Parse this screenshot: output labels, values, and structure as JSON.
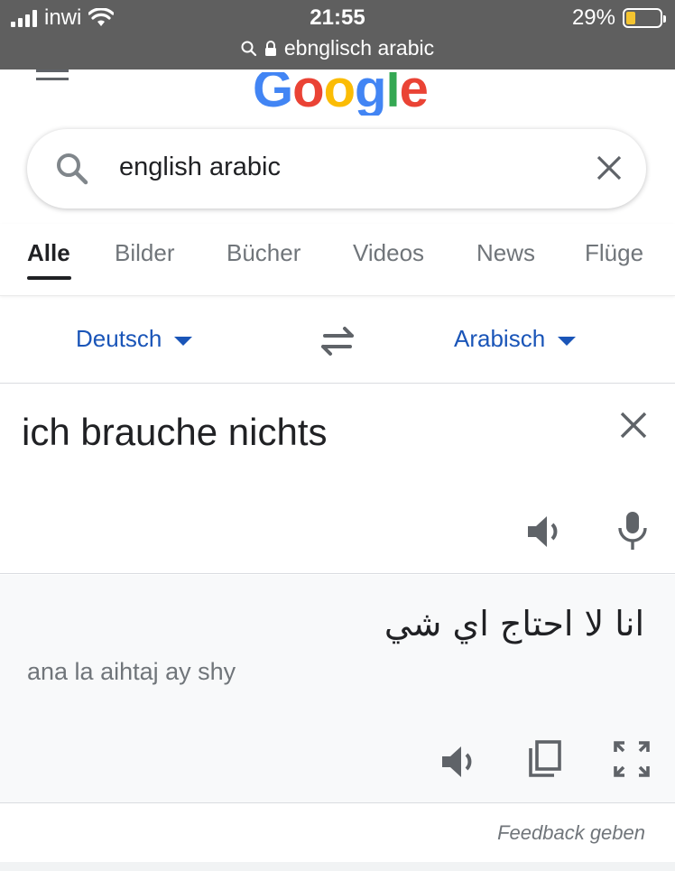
{
  "status_bar": {
    "carrier": "inwi",
    "time": "21:55",
    "battery_percent": "29%",
    "battery_level": 0.29,
    "url": "ebnglisch arabic"
  },
  "logo": {
    "text": "Google",
    "colors": [
      "#4285f4",
      "#ea4335",
      "#fbbc05",
      "#4285f4",
      "#34a853",
      "#ea4335"
    ]
  },
  "search": {
    "query": "english arabic"
  },
  "tabs": [
    {
      "label": "Alle",
      "active": true
    },
    {
      "label": "Bilder",
      "active": false
    },
    {
      "label": "Bücher",
      "active": false
    },
    {
      "label": "Videos",
      "active": false
    },
    {
      "label": "News",
      "active": false
    },
    {
      "label": "Flüge",
      "active": false
    }
  ],
  "translator": {
    "source_language": "Deutsch",
    "target_language": "Arabisch",
    "source_text": "ich brauche nichts",
    "target_text": "انا لا احتاج اي شي",
    "transliteration": "ana la aihtaj ay shy",
    "feedback_label": "Feedback geben"
  },
  "colors": {
    "accent": "#1a55b8",
    "icon_grey": "#5f6368",
    "status_bar": "#5f5f5f"
  }
}
